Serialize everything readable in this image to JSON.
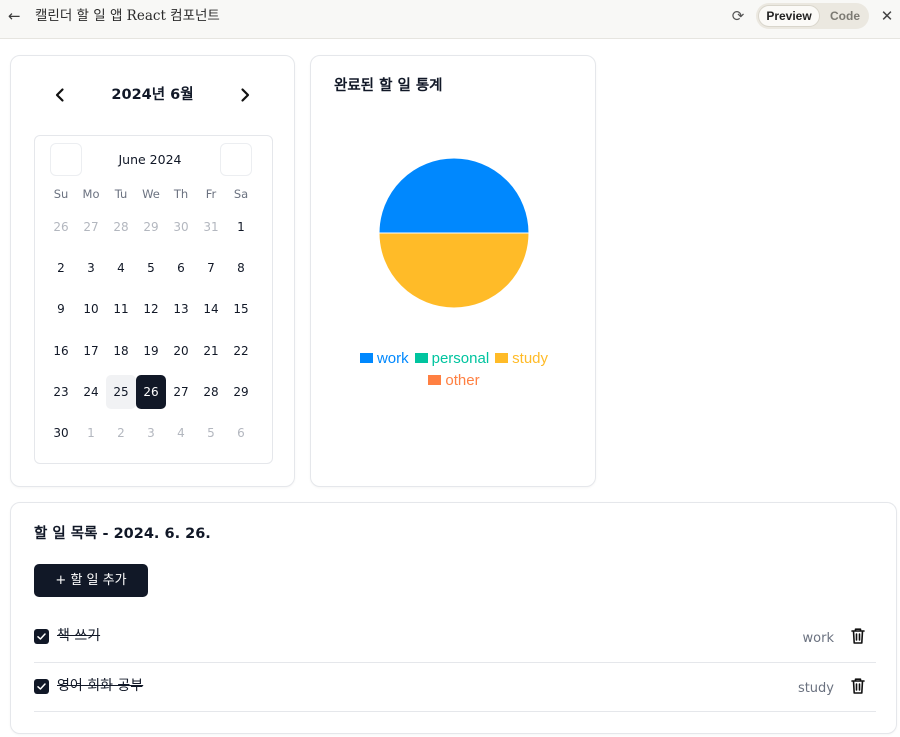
{
  "topbar": {
    "back_icon": "←",
    "title": "캘린더 할 일 앱 React 컴포넌트",
    "refresh_icon": "⟳",
    "tabs": [
      {
        "label": "Preview",
        "active": true
      },
      {
        "label": "Code",
        "active": false
      }
    ],
    "close_icon": "✕"
  },
  "calendar": {
    "title": "2024년 6월",
    "prev_icon": "‹",
    "next_icon": "›",
    "picker": {
      "caption": "June 2024",
      "weekdays": [
        "Su",
        "Mo",
        "Tu",
        "We",
        "Th",
        "Fr",
        "Sa"
      ],
      "weeks": [
        [
          {
            "d": "26",
            "o": true
          },
          {
            "d": "27",
            "o": true
          },
          {
            "d": "28",
            "o": true
          },
          {
            "d": "29",
            "o": true
          },
          {
            "d": "30",
            "o": true
          },
          {
            "d": "31",
            "o": true
          },
          {
            "d": "1"
          }
        ],
        [
          {
            "d": "2"
          },
          {
            "d": "3"
          },
          {
            "d": "4"
          },
          {
            "d": "5"
          },
          {
            "d": "6"
          },
          {
            "d": "7"
          },
          {
            "d": "8"
          }
        ],
        [
          {
            "d": "9"
          },
          {
            "d": "10"
          },
          {
            "d": "11"
          },
          {
            "d": "12"
          },
          {
            "d": "13"
          },
          {
            "d": "14"
          },
          {
            "d": "15"
          }
        ],
        [
          {
            "d": "16"
          },
          {
            "d": "17"
          },
          {
            "d": "18"
          },
          {
            "d": "19"
          },
          {
            "d": "20"
          },
          {
            "d": "21"
          },
          {
            "d": "22"
          }
        ],
        [
          {
            "d": "23"
          },
          {
            "d": "24"
          },
          {
            "d": "25",
            "today": true
          },
          {
            "d": "26",
            "selected": true
          },
          {
            "d": "27"
          },
          {
            "d": "28"
          },
          {
            "d": "29"
          }
        ],
        [
          {
            "d": "30"
          },
          {
            "d": "1",
            "o": true
          },
          {
            "d": "2",
            "o": true
          },
          {
            "d": "3",
            "o": true
          },
          {
            "d": "4",
            "o": true
          },
          {
            "d": "5",
            "o": true
          },
          {
            "d": "6",
            "o": true
          }
        ]
      ]
    }
  },
  "stats": {
    "title": "완료된 할 일 통계"
  },
  "chart_data": {
    "type": "pie",
    "title": "완료된 할 일 통계",
    "categories": [
      "work",
      "personal",
      "study",
      "other"
    ],
    "values": [
      1,
      0,
      1,
      0
    ],
    "colors": [
      "#0088FE",
      "#00C49F",
      "#FFBB28",
      "#FF8042"
    ],
    "legend": "bottom"
  },
  "todos": {
    "title": "할 일 목록 - 2024. 6. 26.",
    "add_button": "+  할 일 추가",
    "items": [
      {
        "text": "책 쓰기",
        "category": "work",
        "done": true
      },
      {
        "text": "영어 회화 공부",
        "category": "study",
        "done": true
      }
    ]
  }
}
